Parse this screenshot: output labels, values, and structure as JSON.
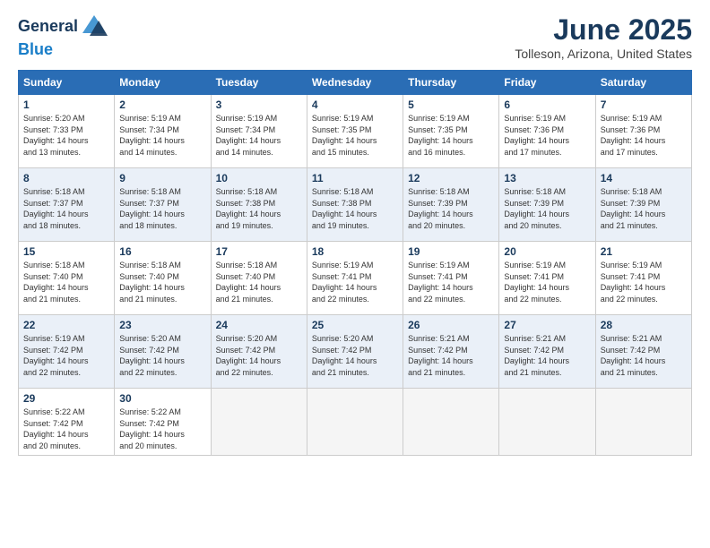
{
  "logo": {
    "line1": "General",
    "line2": "Blue"
  },
  "title": "June 2025",
  "subtitle": "Tolleson, Arizona, United States",
  "header_days": [
    "Sunday",
    "Monday",
    "Tuesday",
    "Wednesday",
    "Thursday",
    "Friday",
    "Saturday"
  ],
  "weeks": [
    [
      {
        "day": "1",
        "info": "Sunrise: 5:20 AM\nSunset: 7:33 PM\nDaylight: 14 hours\nand 13 minutes."
      },
      {
        "day": "2",
        "info": "Sunrise: 5:19 AM\nSunset: 7:34 PM\nDaylight: 14 hours\nand 14 minutes."
      },
      {
        "day": "3",
        "info": "Sunrise: 5:19 AM\nSunset: 7:34 PM\nDaylight: 14 hours\nand 14 minutes."
      },
      {
        "day": "4",
        "info": "Sunrise: 5:19 AM\nSunset: 7:35 PM\nDaylight: 14 hours\nand 15 minutes."
      },
      {
        "day": "5",
        "info": "Sunrise: 5:19 AM\nSunset: 7:35 PM\nDaylight: 14 hours\nand 16 minutes."
      },
      {
        "day": "6",
        "info": "Sunrise: 5:19 AM\nSunset: 7:36 PM\nDaylight: 14 hours\nand 17 minutes."
      },
      {
        "day": "7",
        "info": "Sunrise: 5:19 AM\nSunset: 7:36 PM\nDaylight: 14 hours\nand 17 minutes."
      }
    ],
    [
      {
        "day": "8",
        "info": "Sunrise: 5:18 AM\nSunset: 7:37 PM\nDaylight: 14 hours\nand 18 minutes."
      },
      {
        "day": "9",
        "info": "Sunrise: 5:18 AM\nSunset: 7:37 PM\nDaylight: 14 hours\nand 18 minutes."
      },
      {
        "day": "10",
        "info": "Sunrise: 5:18 AM\nSunset: 7:38 PM\nDaylight: 14 hours\nand 19 minutes."
      },
      {
        "day": "11",
        "info": "Sunrise: 5:18 AM\nSunset: 7:38 PM\nDaylight: 14 hours\nand 19 minutes."
      },
      {
        "day": "12",
        "info": "Sunrise: 5:18 AM\nSunset: 7:39 PM\nDaylight: 14 hours\nand 20 minutes."
      },
      {
        "day": "13",
        "info": "Sunrise: 5:18 AM\nSunset: 7:39 PM\nDaylight: 14 hours\nand 20 minutes."
      },
      {
        "day": "14",
        "info": "Sunrise: 5:18 AM\nSunset: 7:39 PM\nDaylight: 14 hours\nand 21 minutes."
      }
    ],
    [
      {
        "day": "15",
        "info": "Sunrise: 5:18 AM\nSunset: 7:40 PM\nDaylight: 14 hours\nand 21 minutes."
      },
      {
        "day": "16",
        "info": "Sunrise: 5:18 AM\nSunset: 7:40 PM\nDaylight: 14 hours\nand 21 minutes."
      },
      {
        "day": "17",
        "info": "Sunrise: 5:18 AM\nSunset: 7:40 PM\nDaylight: 14 hours\nand 21 minutes."
      },
      {
        "day": "18",
        "info": "Sunrise: 5:19 AM\nSunset: 7:41 PM\nDaylight: 14 hours\nand 22 minutes."
      },
      {
        "day": "19",
        "info": "Sunrise: 5:19 AM\nSunset: 7:41 PM\nDaylight: 14 hours\nand 22 minutes."
      },
      {
        "day": "20",
        "info": "Sunrise: 5:19 AM\nSunset: 7:41 PM\nDaylight: 14 hours\nand 22 minutes."
      },
      {
        "day": "21",
        "info": "Sunrise: 5:19 AM\nSunset: 7:41 PM\nDaylight: 14 hours\nand 22 minutes."
      }
    ],
    [
      {
        "day": "22",
        "info": "Sunrise: 5:19 AM\nSunset: 7:42 PM\nDaylight: 14 hours\nand 22 minutes."
      },
      {
        "day": "23",
        "info": "Sunrise: 5:20 AM\nSunset: 7:42 PM\nDaylight: 14 hours\nand 22 minutes."
      },
      {
        "day": "24",
        "info": "Sunrise: 5:20 AM\nSunset: 7:42 PM\nDaylight: 14 hours\nand 22 minutes."
      },
      {
        "day": "25",
        "info": "Sunrise: 5:20 AM\nSunset: 7:42 PM\nDaylight: 14 hours\nand 21 minutes."
      },
      {
        "day": "26",
        "info": "Sunrise: 5:21 AM\nSunset: 7:42 PM\nDaylight: 14 hours\nand 21 minutes."
      },
      {
        "day": "27",
        "info": "Sunrise: 5:21 AM\nSunset: 7:42 PM\nDaylight: 14 hours\nand 21 minutes."
      },
      {
        "day": "28",
        "info": "Sunrise: 5:21 AM\nSunset: 7:42 PM\nDaylight: 14 hours\nand 21 minutes."
      }
    ],
    [
      {
        "day": "29",
        "info": "Sunrise: 5:22 AM\nSunset: 7:42 PM\nDaylight: 14 hours\nand 20 minutes."
      },
      {
        "day": "30",
        "info": "Sunrise: 5:22 AM\nSunset: 7:42 PM\nDaylight: 14 hours\nand 20 minutes."
      },
      {
        "day": "",
        "info": ""
      },
      {
        "day": "",
        "info": ""
      },
      {
        "day": "",
        "info": ""
      },
      {
        "day": "",
        "info": ""
      },
      {
        "day": "",
        "info": ""
      }
    ]
  ]
}
